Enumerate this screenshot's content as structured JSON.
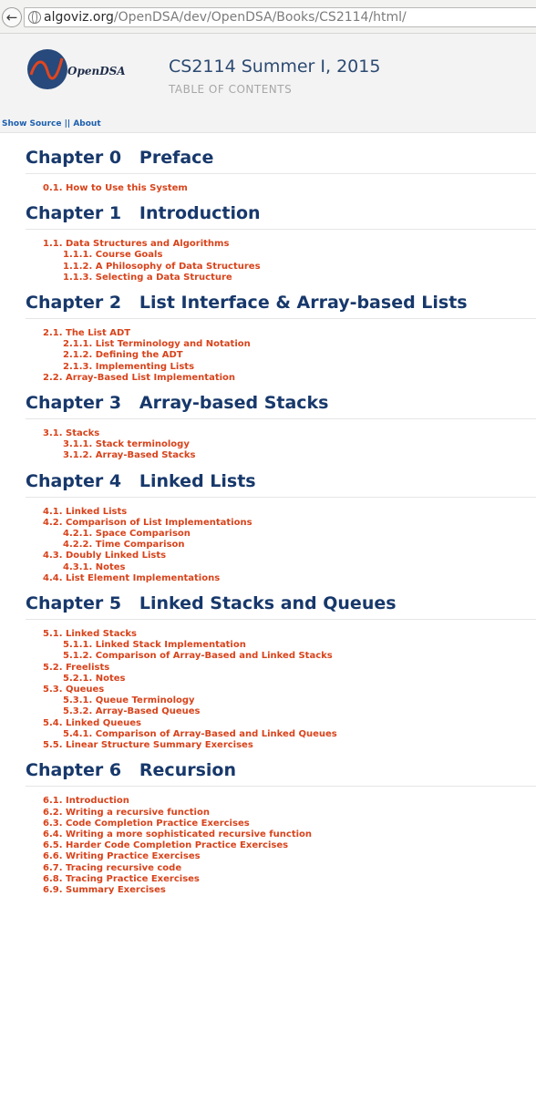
{
  "browser": {
    "url_host": "algoviz.org",
    "url_path": "/OpenDSA/dev/OpenDSA/Books/CS2114/html/"
  },
  "header": {
    "logo_text": "OpenDSA",
    "title": "CS2114 Summer I, 2015",
    "subtitle": "TABLE OF CONTENTS",
    "show_source": "Show Source",
    "separator": "||",
    "about": "About"
  },
  "colors": {
    "heading": "#17386b",
    "link": "#d8431b",
    "toplink": "#1d5fae"
  },
  "chapters": [
    {
      "title": "Chapter 0   Preface",
      "items": [
        {
          "level": 1,
          "text": "0.1. How to Use this System"
        }
      ]
    },
    {
      "title": "Chapter 1   Introduction",
      "items": [
        {
          "level": 1,
          "text": "1.1. Data Structures and Algorithms"
        },
        {
          "level": 2,
          "text": "1.1.1. Course Goals"
        },
        {
          "level": 2,
          "text": "1.1.2. A Philosophy of Data Structures"
        },
        {
          "level": 2,
          "text": "1.1.3. Selecting a Data Structure"
        }
      ]
    },
    {
      "title": "Chapter 2   List Interface & Array-based Lists",
      "items": [
        {
          "level": 1,
          "text": "2.1. The List ADT"
        },
        {
          "level": 2,
          "text": "2.1.1. List Terminology and Notation"
        },
        {
          "level": 2,
          "text": "2.1.2. Defining the ADT"
        },
        {
          "level": 2,
          "text": "2.1.3. Implementing Lists"
        },
        {
          "level": 1,
          "text": "2.2. Array-Based List Implementation"
        }
      ]
    },
    {
      "title": "Chapter 3   Array-based Stacks",
      "items": [
        {
          "level": 1,
          "text": "3.1. Stacks"
        },
        {
          "level": 2,
          "text": "3.1.1. Stack terminology"
        },
        {
          "level": 2,
          "text": "3.1.2. Array-Based Stacks"
        }
      ]
    },
    {
      "title": "Chapter 4   Linked Lists",
      "items": [
        {
          "level": 1,
          "text": "4.1. Linked Lists"
        },
        {
          "level": 1,
          "text": "4.2. Comparison of List Implementations"
        },
        {
          "level": 2,
          "text": "4.2.1. Space Comparison"
        },
        {
          "level": 2,
          "text": "4.2.2. Time Comparison"
        },
        {
          "level": 1,
          "text": "4.3. Doubly Linked Lists"
        },
        {
          "level": 2,
          "text": "4.3.1. Notes"
        },
        {
          "level": 1,
          "text": "4.4. List Element Implementations"
        }
      ]
    },
    {
      "title": "Chapter 5   Linked Stacks and Queues",
      "items": [
        {
          "level": 1,
          "text": "5.1. Linked Stacks"
        },
        {
          "level": 2,
          "text": "5.1.1. Linked Stack Implementation"
        },
        {
          "level": 2,
          "text": "5.1.2. Comparison of Array-Based and Linked Stacks"
        },
        {
          "level": 1,
          "text": "5.2. Freelists"
        },
        {
          "level": 2,
          "text": "5.2.1. Notes"
        },
        {
          "level": 1,
          "text": "5.3. Queues"
        },
        {
          "level": 2,
          "text": "5.3.1. Queue Terminology"
        },
        {
          "level": 2,
          "text": "5.3.2. Array-Based Queues"
        },
        {
          "level": 1,
          "text": "5.4. Linked Queues"
        },
        {
          "level": 2,
          "text": "5.4.1. Comparison of Array-Based and Linked Queues"
        },
        {
          "level": 1,
          "text": "5.5. Linear Structure Summary Exercises"
        }
      ]
    },
    {
      "title": "Chapter 6   Recursion",
      "items": [
        {
          "level": 1,
          "text": "6.1. Introduction"
        },
        {
          "level": 1,
          "text": "6.2. Writing a recursive function"
        },
        {
          "level": 1,
          "text": "6.3. Code Completion Practice Exercises"
        },
        {
          "level": 1,
          "text": "6.4. Writing a more sophisticated recursive function"
        },
        {
          "level": 1,
          "text": "6.5. Harder Code Completion Practice Exercises"
        },
        {
          "level": 1,
          "text": "6.6. Writing Practice Exercises"
        },
        {
          "level": 1,
          "text": "6.7. Tracing recursive code"
        },
        {
          "level": 1,
          "text": "6.8. Tracing Practice Exercises"
        },
        {
          "level": 1,
          "text": "6.9. Summary Exercises"
        }
      ]
    }
  ]
}
